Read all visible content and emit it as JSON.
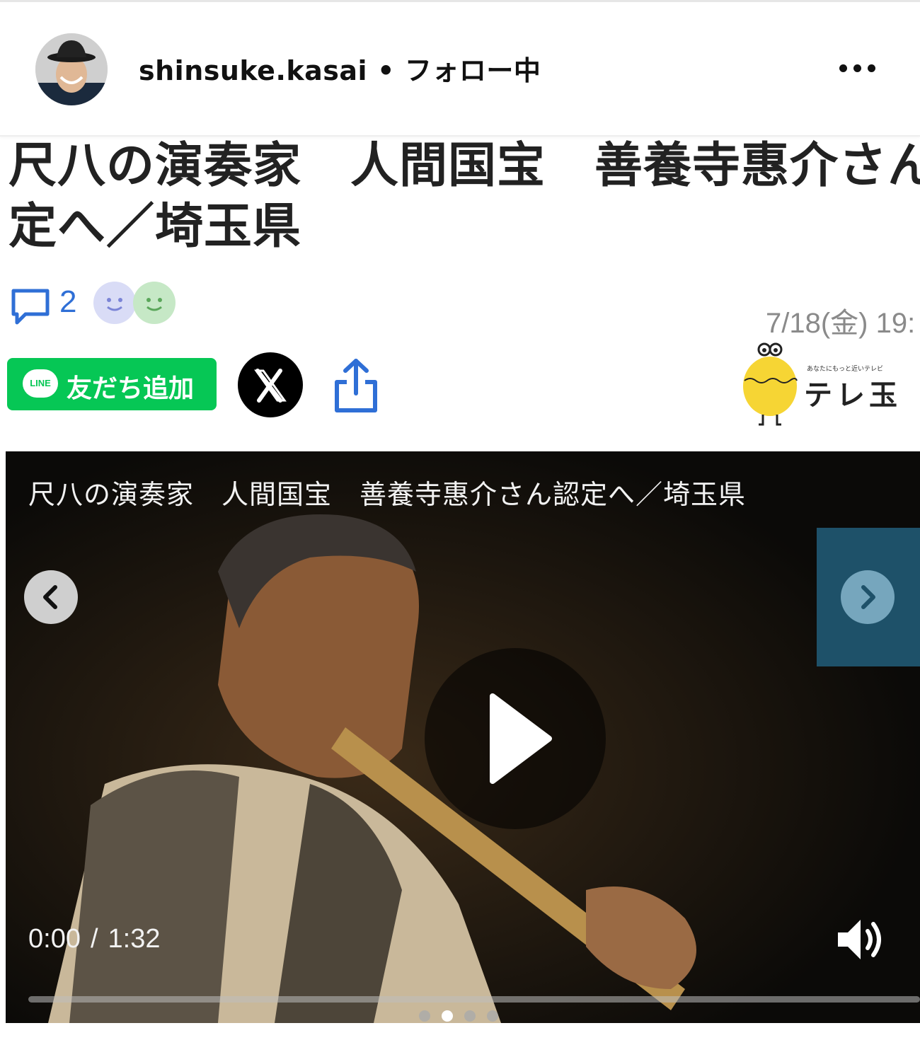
{
  "header": {
    "username": "shinsuke.kasai",
    "separator": "•",
    "follow_status": "フォロー中"
  },
  "article": {
    "headline_line1": "尺八の演奏家　人間国宝　善養寺惠介さん",
    "headline_line2": "定へ／埼玉県",
    "comment_count": "2",
    "timestamp": "7/18(金) 19:"
  },
  "share": {
    "line_logo_text": "LINE",
    "line_label": "友だち追加"
  },
  "brand": {
    "tagline": "あなたにもっと近いテレビ",
    "name": "テレ玉"
  },
  "video": {
    "title": "尺八の演奏家　人間国宝　善養寺惠介さん認定へ／埼玉県",
    "current_time": "0:00",
    "time_separator": "/",
    "duration": "1:32",
    "progress_fraction": 0,
    "slide_count": 4,
    "active_slide": 2
  },
  "icons": {
    "more": "more-horizontal-icon",
    "comment": "comment-bubble-icon",
    "share": "share-upload-icon",
    "x": "x-logo-icon",
    "play": "play-icon",
    "volume": "volume-icon"
  },
  "colors": {
    "accent_blue": "#2f6fd6",
    "line_green": "#06c755",
    "video_bg": "#0b0a08",
    "next_panel": "#1e5169"
  }
}
